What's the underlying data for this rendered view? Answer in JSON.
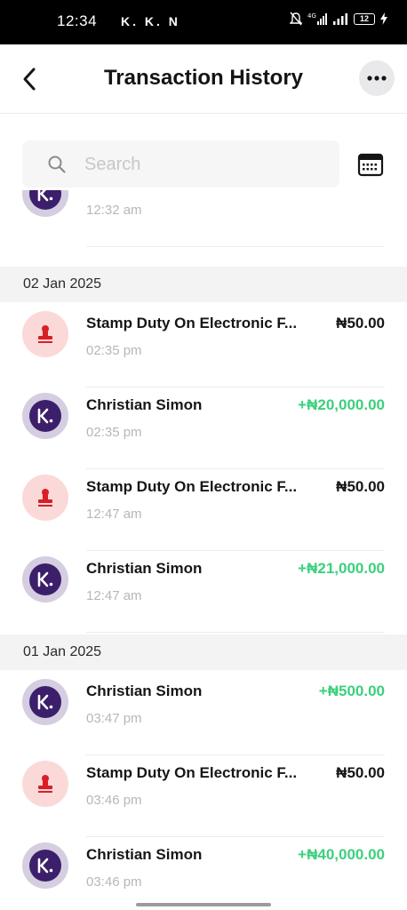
{
  "status_bar": {
    "time": "12:34",
    "notification_icons": "K. K. N",
    "network_label": "4G",
    "battery": "12"
  },
  "header": {
    "title": "Transaction History",
    "back_icon": "chevron-left-icon",
    "more_icon": "ellipsis-icon"
  },
  "search": {
    "placeholder": "Search",
    "icon": "search-icon",
    "calendar_icon": "calendar-icon"
  },
  "partial_row": {
    "time": "12:32 am",
    "type": "k"
  },
  "groups": [
    {
      "date": "02 Jan 2025",
      "items": [
        {
          "name": "Stamp Duty On Electronic F...",
          "time": "02:35 pm",
          "amount": "₦50.00",
          "type": "stamp",
          "direction": "debit"
        },
        {
          "name": "Christian  Simon",
          "time": "02:35 pm",
          "amount": "+₦20,000.00",
          "type": "k",
          "direction": "credit"
        },
        {
          "name": "Stamp Duty On Electronic F...",
          "time": "12:47 am",
          "amount": "₦50.00",
          "type": "stamp",
          "direction": "debit"
        },
        {
          "name": "Christian  Simon",
          "time": "12:47 am",
          "amount": "+₦21,000.00",
          "type": "k",
          "direction": "credit"
        }
      ]
    },
    {
      "date": "01 Jan 2025",
      "items": [
        {
          "name": "Christian  Simon",
          "time": "03:47 pm",
          "amount": "+₦500.00",
          "type": "k",
          "direction": "credit"
        },
        {
          "name": "Stamp Duty On Electronic F...",
          "time": "03:46 pm",
          "amount": "₦50.00",
          "type": "stamp",
          "direction": "debit"
        },
        {
          "name": "Christian  Simon",
          "time": "03:46 pm",
          "amount": "+₦40,000.00",
          "type": "k",
          "direction": "credit"
        }
      ]
    }
  ],
  "colors": {
    "credit": "#3ccf7e",
    "debit": "#161616",
    "stamp_icon": "#d91f26",
    "stamp_bg": "#fbd9d9",
    "brand_purple": "#3c1f6b",
    "brand_ring": "#d5cde0"
  }
}
